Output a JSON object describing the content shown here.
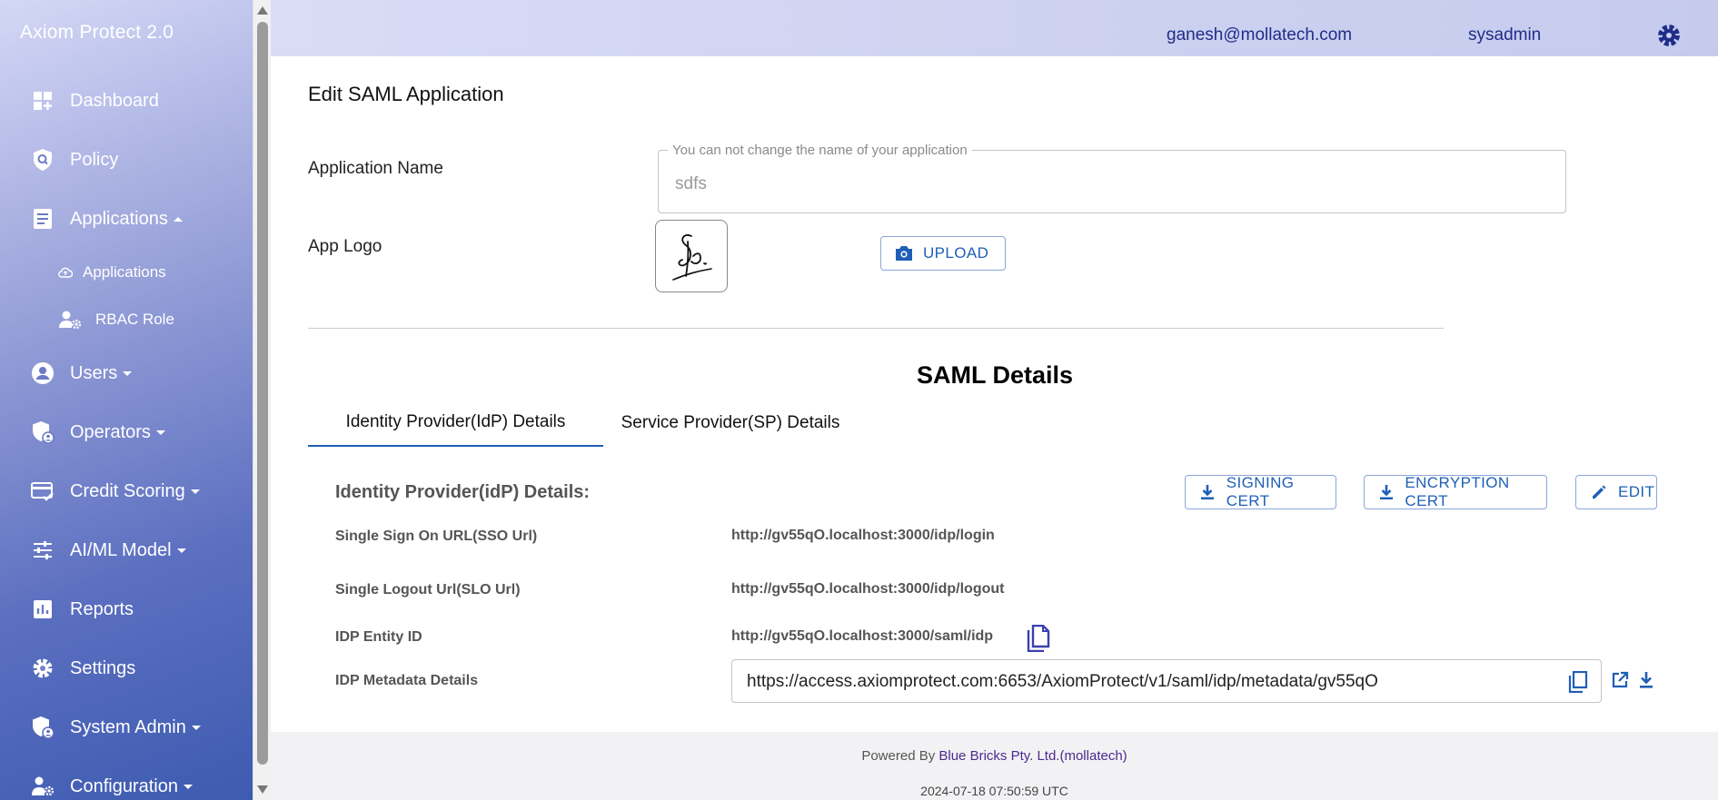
{
  "app": {
    "title": "Axiom Protect 2.0"
  },
  "header": {
    "email": "ganesh@mollatech.com",
    "role": "sysadmin"
  },
  "sidebar": {
    "items": [
      {
        "label": "Dashboard"
      },
      {
        "label": "Policy"
      },
      {
        "label": "Applications",
        "expanded": true
      },
      {
        "label": "Users",
        "expanded": false
      },
      {
        "label": "Operators",
        "expanded": false
      },
      {
        "label": "Credit Scoring",
        "expanded": false
      },
      {
        "label": "AI/ML Model",
        "expanded": false
      },
      {
        "label": "Reports"
      },
      {
        "label": "Settings"
      },
      {
        "label": "System Admin",
        "expanded": false
      },
      {
        "label": "Configuration",
        "expanded": false
      }
    ],
    "subitems": [
      {
        "label": "Applications"
      },
      {
        "label": "RBAC Role"
      }
    ]
  },
  "page": {
    "title": "Edit SAML Application",
    "app_name_label": "Application Name",
    "app_name_legend": "You can not change the name of your application",
    "app_name_value": "sdfs",
    "app_logo_label": "App Logo",
    "upload_label": "UPLOAD"
  },
  "saml": {
    "title": "SAML Details",
    "tabs": [
      {
        "label": "Identity Provider(IdP) Details",
        "active": true
      },
      {
        "label": "Service Provider(SP) Details",
        "active": false
      }
    ],
    "idp": {
      "heading": "Identity Provider(idP) Details:",
      "signing_cert_label": "SIGNING CERT",
      "encryption_cert_label": "ENCRYPTION CERT",
      "edit_label": "EDIT",
      "rows": [
        {
          "label": "Single Sign On URL(SSO Url)",
          "value": "http://gv55qO.localhost:3000/idp/login"
        },
        {
          "label": "Single Logout Url(SLO Url)",
          "value": "http://gv55qO.localhost:3000/idp/logout"
        },
        {
          "label": "IDP Entity ID",
          "value": "http://gv55qO.localhost:3000/saml/idp"
        },
        {
          "label": "IDP Metadata Details",
          "value": "https://access.axiomprotect.com:6653/AxiomProtect/v1/saml/idp/metadata/gv55qO"
        }
      ]
    }
  },
  "footer": {
    "powered_prefix": "Powered By ",
    "powered_link": "Blue Bricks Pty. Ltd.(mollatech)",
    "timestamp": "2024-07-18 07:50:59 UTC"
  },
  "colors": {
    "accent": "#1f5fb5",
    "header_text": "#1f2d8a",
    "copy_icon": "#3b3fb0"
  },
  "icons": [
    "dashboard-icon",
    "policy-icon",
    "applications-icon",
    "users-icon",
    "operators-icon",
    "credit-scoring-icon",
    "aiml-icon",
    "reports-icon",
    "settings-icon",
    "system-admin-icon",
    "configuration-icon",
    "gear-icon",
    "camera-icon",
    "download-icon",
    "edit-icon",
    "copy-icon",
    "open-external-icon"
  ]
}
